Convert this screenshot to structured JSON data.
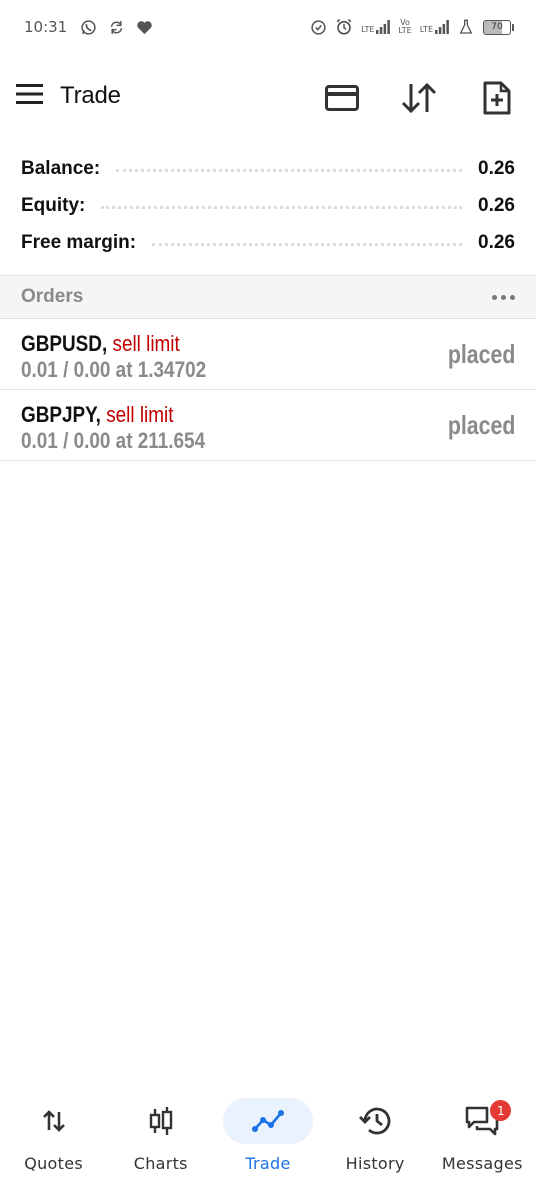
{
  "status_bar": {
    "time": "10:31",
    "left_icons": [
      "whatsapp-icon",
      "sync-icon",
      "heart-icon"
    ],
    "right_icons": [
      "data-saver-icon",
      "alarm-icon",
      "lte-signal-icon",
      "volte-icon",
      "lte-signal-2-icon",
      "flask-icon"
    ],
    "lte_label": "LTE",
    "volte_label_top": "Vo",
    "volte_label_bottom": "LTE",
    "battery_level": "70"
  },
  "app_bar": {
    "title": "Trade",
    "actions": [
      "card-icon",
      "sort-arrows-icon",
      "new-document-icon"
    ]
  },
  "account": {
    "balance_label": "Balance:",
    "balance_value": "0.26",
    "equity_label": "Equity:",
    "equity_value": "0.26",
    "free_margin_label": "Free margin:",
    "free_margin_value": "0.26"
  },
  "orders": {
    "title": "Orders",
    "items": [
      {
        "symbol": "GBPUSD,",
        "type": "sell limit",
        "details": "0.01 / 0.00 at 1.34702",
        "status": "placed"
      },
      {
        "symbol": "GBPJPY,",
        "type": "sell limit",
        "details": "0.01 / 0.00 at 211.654",
        "status": "placed"
      }
    ]
  },
  "bottom_nav": {
    "items": [
      {
        "label": "Quotes",
        "icon": "quotes-arrows-icon",
        "active": false
      },
      {
        "label": "Charts",
        "icon": "candlestick-icon",
        "active": false
      },
      {
        "label": "Trade",
        "icon": "trade-line-icon",
        "active": true
      },
      {
        "label": "History",
        "icon": "history-icon",
        "active": false
      },
      {
        "label": "Messages",
        "icon": "messages-icon",
        "active": false,
        "badge": "1"
      }
    ]
  },
  "colors": {
    "accent": "#1a73e8",
    "sell": "#c00000",
    "muted_text": "#8a8a8a",
    "badge": "#e53935"
  }
}
